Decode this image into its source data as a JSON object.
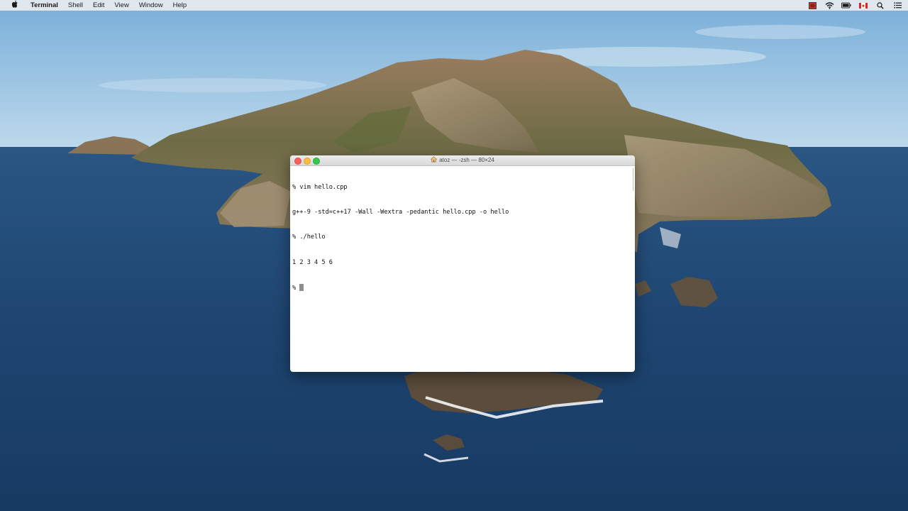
{
  "menubar": {
    "apple_icon": "apple-logo-icon",
    "app_name": "Terminal",
    "items": [
      "Shell",
      "Edit",
      "View",
      "Window",
      "Help"
    ],
    "status_icons": [
      "flag-red-icon",
      "wifi-icon",
      "battery-icon",
      "flag-canada-icon",
      "search-icon",
      "list-icon"
    ]
  },
  "terminal": {
    "title": "atoz — -zsh — 80×24",
    "title_icon": "home-icon",
    "lines": [
      "% vim hello.cpp",
      "g++-9 -std=c++17 -Wall -Wextra -pedantic hello.cpp -o hello",
      "% ./hello",
      "1 2 3 4 5 6",
      "% "
    ]
  },
  "colors": {
    "close": "#fc605c",
    "minimize": "#fdbc40",
    "zoom": "#34c84a"
  }
}
